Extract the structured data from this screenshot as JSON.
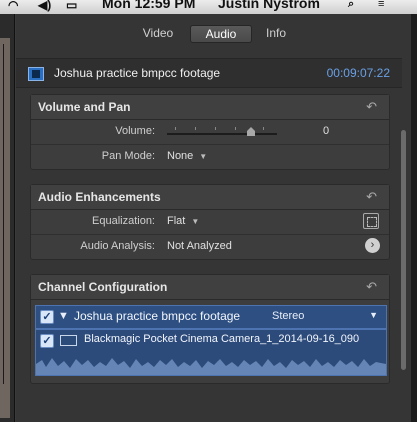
{
  "menubar": {
    "icons": [
      "wifi-icon",
      "volume-icon",
      "battery-icon"
    ],
    "clock": "Mon 12:59 PM",
    "user": "Justin Nystrom"
  },
  "tabs": [
    {
      "label": "Video",
      "active": false
    },
    {
      "label": "Audio",
      "active": true
    },
    {
      "label": "Info",
      "active": false
    }
  ],
  "clip": {
    "name": "Joshua practice bmpcc footage",
    "timecode": "00:09:07:22"
  },
  "volume_pan": {
    "title": "Volume and Pan",
    "volume_label": "Volume:",
    "volume_value": "0",
    "pan_label": "Pan Mode:",
    "pan_value": "None"
  },
  "audio_enhancements": {
    "title": "Audio Enhancements",
    "eq_label": "Equalization:",
    "eq_value": "Flat",
    "analysis_label": "Audio Analysis:",
    "analysis_value": "Not Analyzed"
  },
  "channel_config": {
    "title": "Channel Configuration",
    "group_name": "Joshua practice bmpcc footage",
    "group_mode": "Stereo",
    "clip_name": "Blackmagic Pocket Cinema Camera_1_2014-09-16_090"
  },
  "colors": {
    "accent_blue": "#6aa0e6",
    "channel_bg": "#2d4f82"
  }
}
